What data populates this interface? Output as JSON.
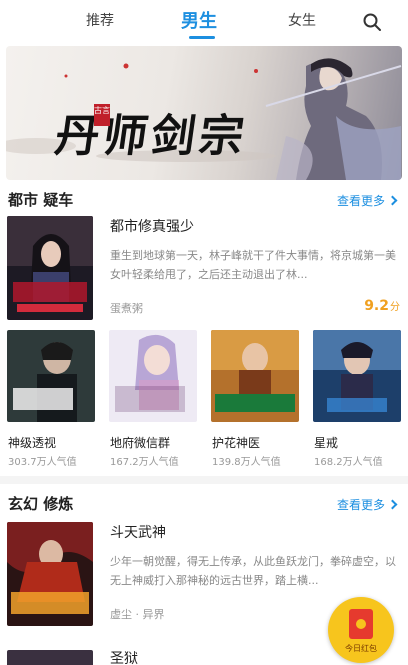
{
  "nav": {
    "tabs": [
      {
        "label": "推荐"
      },
      {
        "label": "男生"
      },
      {
        "label": "女生"
      }
    ],
    "active": "男生"
  },
  "banner": {
    "title": "丹师剑宗",
    "seal": "古言"
  },
  "section1": {
    "title": "都市 疑车",
    "more": "查看更多",
    "featured": {
      "title": "都市修真强少",
      "desc": "重生到地球第一天，林子峰就干了件大事情，将京城第一美女叶轻柔给甩了，之后还主动退出了林...",
      "author": "蛋煮粥",
      "score": "9.2",
      "score_unit": "分"
    },
    "grid": [
      {
        "title": "神级透视",
        "pop": "303.7万人气值"
      },
      {
        "title": "地府微信群",
        "pop": "167.2万人气值"
      },
      {
        "title": "护花神医",
        "pop": "139.8万人气值"
      },
      {
        "title": "星戒",
        "pop": "168.2万人气值"
      }
    ]
  },
  "section2": {
    "title": "玄幻 修炼",
    "more": "查看更多",
    "featured": {
      "title": "斗天武神",
      "desc": "少年一朝觉醒，得无上传承，从此鱼跃龙门，拳碎虚空，以无上神威打入那神秘的远古世界，踏上横...",
      "author": "虚尘 · 异界"
    },
    "next_title": "圣狱"
  },
  "float": {
    "label": "今日红包"
  },
  "colors": {
    "accent": "#1d8fe0",
    "score": "#f0a020",
    "float_bg": "#f7c51d",
    "envelope": "#e63a2e"
  }
}
